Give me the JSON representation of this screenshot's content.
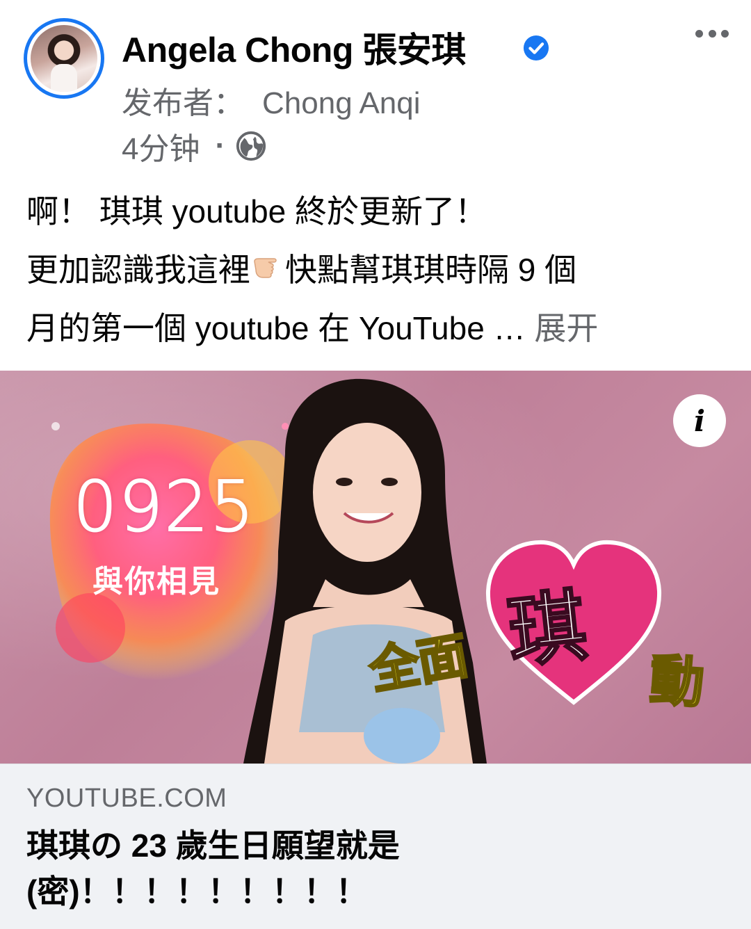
{
  "post": {
    "author": "Angela Chong 張安琪",
    "publisher_label": "发布者：",
    "publisher_name": "Chong Anqi",
    "time": "4分钟",
    "separator": "·",
    "body_lines": [
      "啊！ 琪琪 youtube 終於更新了！",
      "更加認識我這裡",
      "快點幫琪琪時隔 9 個",
      "月的第一個 youtube 在 YouTube …",
      "展开"
    ]
  },
  "link_preview": {
    "thumbnail_text": {
      "date": "0925",
      "meet": "與你相見",
      "slogan_1": "全面",
      "slogan_2": "琪",
      "slogan_3": "動"
    },
    "info_glyph": "i",
    "domain": "YOUTUBE.COM",
    "title_lines": [
      "琪琪の 23 歲生日願望就是",
      "(密)！！！！！！！！！"
    ]
  },
  "icons": {
    "verified": "verified-badge-icon",
    "more": "more-options-icon",
    "audience": "globe-icon",
    "pointing": "pointing-hand-icon",
    "info": "info-icon"
  },
  "colors": {
    "accent": "#1877f2",
    "secondary_text": "#65676b",
    "primary_text": "#050505",
    "preview_bg": "#c68aa1",
    "footer_bg": "#f0f2f5"
  }
}
